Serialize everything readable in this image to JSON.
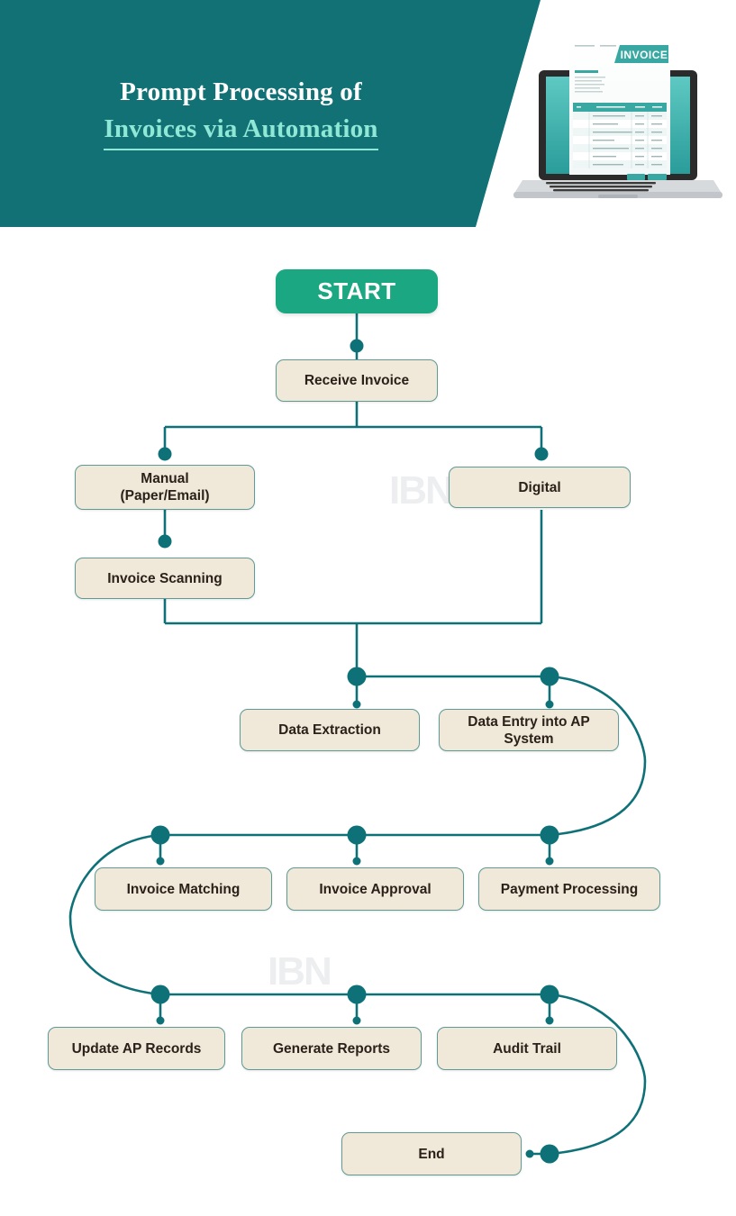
{
  "header": {
    "title_line1": "Prompt Processing of",
    "title_line2": "Invoices via Automation",
    "bg_color": "#117175",
    "accent_color": "#8fe8d5",
    "illustration": "laptop-invoice-illustration",
    "invoice_label": "INVOICE"
  },
  "watermark": {
    "text": "IBN",
    "color": "#eceef0"
  },
  "theme": {
    "teal": "#0f7178",
    "green": "#1aa781",
    "node_fill": "#f0e9da",
    "node_border": "#5f9a94",
    "node_text": "#2b2118",
    "page_bg": "#ffffff"
  },
  "chart_data": {
    "type": "diagram",
    "title": "Prompt Processing of Invoices via Automation",
    "nodes": [
      {
        "id": "start",
        "label": "START",
        "row": 0,
        "kind": "terminator"
      },
      {
        "id": "receive",
        "label": "Receive Invoice",
        "row": 1,
        "kind": "process"
      },
      {
        "id": "manual",
        "label": "Manual\n(Paper/Email)",
        "row": 2,
        "kind": "process"
      },
      {
        "id": "digital",
        "label": "Digital",
        "row": 2,
        "kind": "process"
      },
      {
        "id": "scanning",
        "label": "Invoice Scanning",
        "row": 3,
        "kind": "process"
      },
      {
        "id": "extraction",
        "label": "Data Extraction",
        "row": 4,
        "kind": "process"
      },
      {
        "id": "dataentry",
        "label": "Data Entry into AP\nSystem",
        "row": 4,
        "kind": "process"
      },
      {
        "id": "matching",
        "label": "Invoice Matching",
        "row": 5,
        "kind": "process"
      },
      {
        "id": "approval",
        "label": "Invoice Approval",
        "row": 5,
        "kind": "process"
      },
      {
        "id": "payment",
        "label": "Payment Processing",
        "row": 5,
        "kind": "process"
      },
      {
        "id": "updateap",
        "label": "Update AP Records",
        "row": 6,
        "kind": "process"
      },
      {
        "id": "reports",
        "label": "Generate Reports",
        "row": 6,
        "kind": "process"
      },
      {
        "id": "audit",
        "label": "Audit Trail",
        "row": 6,
        "kind": "process"
      },
      {
        "id": "end",
        "label": "End",
        "row": 7,
        "kind": "terminator"
      }
    ],
    "edges": [
      {
        "from": "start",
        "to": "receive"
      },
      {
        "from": "receive",
        "to": "manual"
      },
      {
        "from": "receive",
        "to": "digital"
      },
      {
        "from": "manual",
        "to": "scanning"
      },
      {
        "from": "scanning",
        "to": "extraction"
      },
      {
        "from": "digital",
        "to": "extraction"
      },
      {
        "from": "extraction",
        "to": "dataentry"
      },
      {
        "from": "dataentry",
        "to": "matching"
      },
      {
        "from": "matching",
        "to": "approval"
      },
      {
        "from": "approval",
        "to": "payment"
      },
      {
        "from": "payment",
        "to": "updateap"
      },
      {
        "from": "updateap",
        "to": "reports"
      },
      {
        "from": "reports",
        "to": "audit"
      },
      {
        "from": "audit",
        "to": "end"
      }
    ]
  },
  "nodes": {
    "start": {
      "label": "START"
    },
    "receive": {
      "label": "Receive Invoice"
    },
    "manual_l1": {
      "label": "Manual"
    },
    "manual_l2": {
      "label": "(Paper/Email)"
    },
    "digital": {
      "label": "Digital"
    },
    "scanning": {
      "label": "Invoice Scanning"
    },
    "extraction": {
      "label": "Data Extraction"
    },
    "dataentry_l1": {
      "label": "Data Entry into AP"
    },
    "dataentry_l2": {
      "label": "System"
    },
    "matching": {
      "label": "Invoice Matching"
    },
    "approval": {
      "label": "Invoice Approval"
    },
    "payment": {
      "label": "Payment Processing"
    },
    "updateap": {
      "label": "Update AP Records"
    },
    "reports": {
      "label": "Generate Reports"
    },
    "audit": {
      "label": "Audit Trail"
    },
    "end": {
      "label": "End"
    }
  }
}
